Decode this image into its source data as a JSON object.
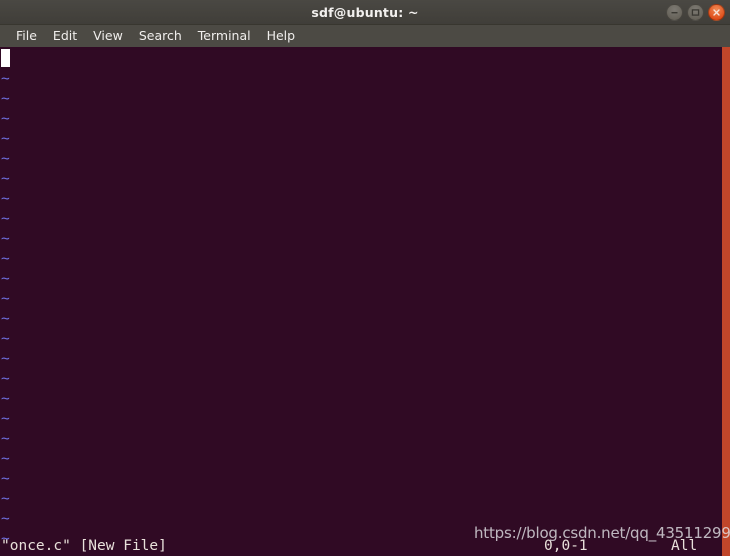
{
  "window": {
    "title": "sdf@ubuntu: ~",
    "buttons": [
      {
        "name": "minimize",
        "glyph": "minimize-icon"
      },
      {
        "name": "maximize",
        "glyph": "maximize-icon"
      },
      {
        "name": "close",
        "glyph": "close-icon"
      }
    ],
    "accent_close_color": "#dd4814",
    "titlebar_color": "#45433e",
    "menubar_color": "#4c4a44"
  },
  "menubar": {
    "items": [
      {
        "label": "File"
      },
      {
        "label": "Edit"
      },
      {
        "label": "View"
      },
      {
        "label": "Search"
      },
      {
        "label": "Terminal"
      },
      {
        "label": "Help"
      }
    ]
  },
  "terminal": {
    "background_color": "#300a24",
    "foreground_color": "#e8e0da",
    "tilde_color": "#6f6fe0",
    "cursor_color": "#ffffff",
    "editor": "vim",
    "empty_line_marker": "~",
    "empty_line_count": 24,
    "cursor_row": 1,
    "cursor_col": 1
  },
  "statusline": {
    "file_message": "\"once.c\" [New File]",
    "position": "0,0-1",
    "percent": "All"
  },
  "watermark": {
    "text": "https://blog.csdn.net/qq_43511299"
  }
}
